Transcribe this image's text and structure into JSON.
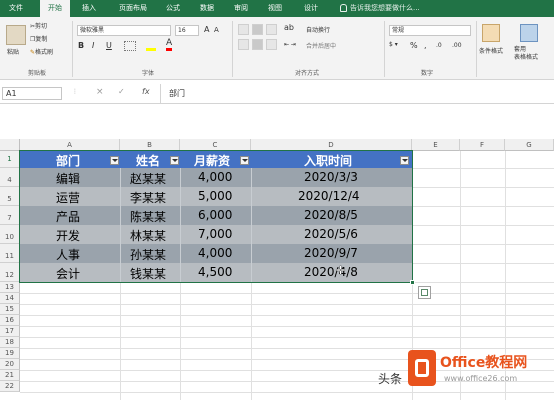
{
  "ribbon": {
    "tabs": [
      "文件",
      "开始",
      "插入",
      "页面布局",
      "公式",
      "数据",
      "审阅",
      "视图",
      "设计"
    ],
    "tell_me": "告诉我您想要做什么...",
    "clipboard": {
      "paste": "粘贴",
      "cut": "剪切",
      "copy": "复制",
      "format_painter": "格式刷",
      "group": "剪贴板"
    },
    "font": {
      "name": "微软雅黑",
      "size": "16",
      "group": "字体",
      "bold": "B",
      "italic": "I",
      "underline": "U",
      "font_color_icon": "A"
    },
    "alignment": {
      "wrap": "自动换行",
      "merge": "合并后居中",
      "group": "对齐方式"
    },
    "number": {
      "format": "常规",
      "percent": "%",
      "comma": ",",
      "group": "数字"
    },
    "styles": {
      "conditional": "条件格式",
      "table_format": "套用\n表格格式"
    }
  },
  "formula_bar": {
    "name_box": "A1",
    "cancel": "×",
    "enter": "✓",
    "fx": "fx",
    "content": "部门"
  },
  "columns": [
    "A",
    "B",
    "C",
    "D",
    "E",
    "F",
    "G"
  ],
  "row_numbers": [
    "1",
    "4",
    "5",
    "7",
    "10",
    "11",
    "12",
    "13",
    "14",
    "15",
    "16",
    "17",
    "18",
    "19",
    "20",
    "21",
    "22"
  ],
  "table": {
    "headers": [
      "部门",
      "姓名",
      "月薪资",
      "入职时间"
    ],
    "rows": [
      [
        "编辑",
        "赵某某",
        "4,000",
        "2020/3/3"
      ],
      [
        "运营",
        "李某某",
        "5,000",
        "2020/12/4"
      ],
      [
        "产品",
        "陈某某",
        "6,000",
        "2020/8/5"
      ],
      [
        "开发",
        "林某某",
        "7,000",
        "2020/5/6"
      ],
      [
        "人事",
        "孙某某",
        "4,000",
        "2020/9/7"
      ],
      [
        "会计",
        "钱某某",
        "4,500",
        "2020/4/8"
      ]
    ]
  },
  "watermark": {
    "left_text": "头条",
    "brand_text": "Office教程网",
    "url": "www.office26.com"
  },
  "colors": {
    "excel_green": "#217346",
    "header_blue": "#4472c4",
    "band_dark": "#9aa3ac",
    "band_light": "#b7bcc1",
    "watermark_orange": "#e8531d"
  }
}
